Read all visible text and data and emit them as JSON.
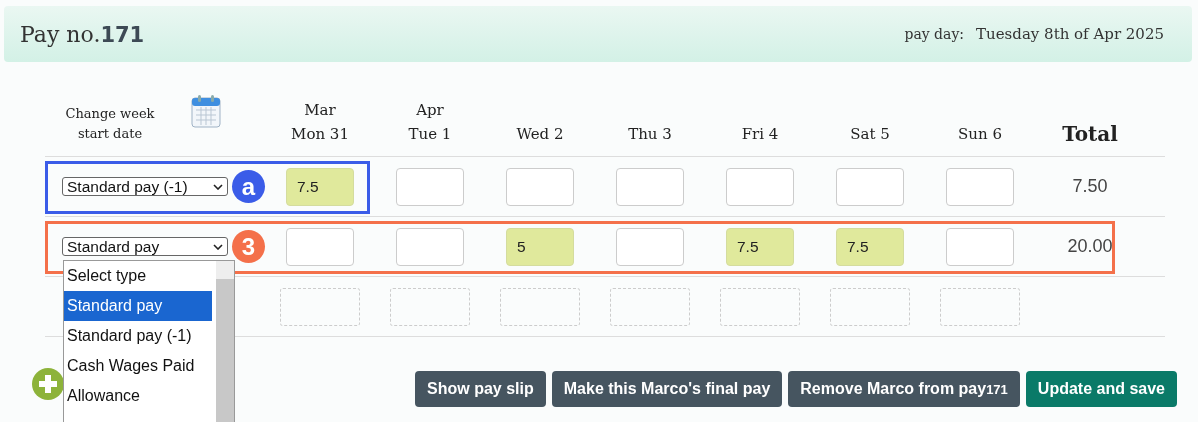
{
  "header": {
    "title_prefix": "Pay no.",
    "pay_number": "171",
    "pay_day_label": "pay day:",
    "pay_day": "Tuesday 8th of Apr 2025"
  },
  "columns": {
    "change_week": "Change week start date",
    "total": "Total",
    "days": [
      {
        "month": "Mar",
        "day": "Mon 31"
      },
      {
        "month": "Apr",
        "day": "Tue 1"
      },
      {
        "day": "Wed 2"
      },
      {
        "day": "Thu 3"
      },
      {
        "day": "Fri 4"
      },
      {
        "day": "Sat 5"
      },
      {
        "day": "Sun 6"
      }
    ]
  },
  "rows": [
    {
      "kind": "entry",
      "type": "Standard pay (-1)",
      "hours": [
        {
          "filled": true,
          "value": "7.5"
        },
        {
          "filled": false
        },
        {
          "filled": false
        },
        {
          "filled": false
        },
        {
          "filled": false
        },
        {
          "filled": false
        },
        {
          "filled": false
        }
      ],
      "total": "7.50",
      "removable": false,
      "marker": {
        "label": "a",
        "color": "#3b5ce8"
      }
    },
    {
      "kind": "entry",
      "type": "Standard pay",
      "hours": [
        {
          "filled": false
        },
        {
          "filled": false
        },
        {
          "filled": true,
          "value": "5"
        },
        {
          "filled": false
        },
        {
          "filled": true,
          "value": "7.5"
        },
        {
          "filled": true,
          "value": "7.5"
        },
        {
          "filled": false
        }
      ],
      "total": "20.00",
      "removable": true,
      "marker": {
        "label": "3",
        "color": "#f4704a"
      },
      "dropdown": {
        "open": true,
        "options": [
          {
            "label": "Select type",
            "selected": false
          },
          {
            "label": "Standard pay",
            "selected": true
          },
          {
            "label": "Standard pay (-1)",
            "selected": false
          },
          {
            "label": "Cash Wages Paid",
            "selected": false
          },
          {
            "label": "Allowance",
            "selected": false
          }
        ]
      }
    },
    {
      "kind": "blank"
    }
  ],
  "buttons": [
    {
      "label": "Show pay slip",
      "kind": "secondary"
    },
    {
      "label": "Make this Marco's final pay",
      "kind": "secondary"
    },
    {
      "label": "Remove Marco from pay",
      "suffix": "171",
      "kind": "secondary"
    },
    {
      "label": "Update and save",
      "kind": "primary"
    }
  ]
}
